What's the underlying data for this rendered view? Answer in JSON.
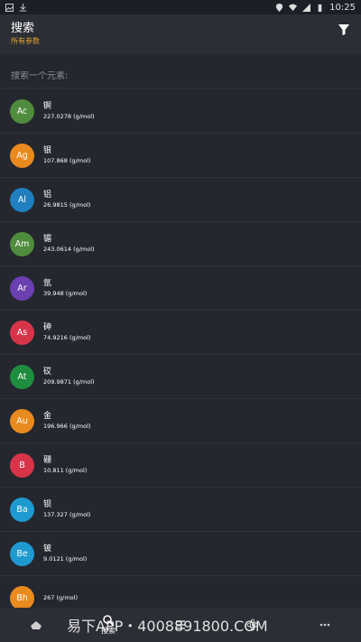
{
  "status_bar": {
    "time": "10:25"
  },
  "app_bar": {
    "title": "搜索",
    "subtitle": "所有参数"
  },
  "search": {
    "placeholder": "搜索一个元素:"
  },
  "elements": [
    {
      "symbol": "Ac",
      "name": "锕",
      "mass": "227.0278 (g/mol)",
      "color": "#4f8c3d"
    },
    {
      "symbol": "Ag",
      "name": "银",
      "mass": "107.868 (g/mol)",
      "color": "#e98a1e"
    },
    {
      "symbol": "Al",
      "name": "铝",
      "mass": "26.9815 (g/mol)",
      "color": "#1f7fbf"
    },
    {
      "symbol": "Am",
      "name": "镅",
      "mass": "243.0614 (g/mol)",
      "color": "#4f8c3d"
    },
    {
      "symbol": "Ar",
      "name": "氩",
      "mass": "39.948 (g/mol)",
      "color": "#6a3fb0"
    },
    {
      "symbol": "As",
      "name": "砷",
      "mass": "74.9216 (g/mol)",
      "color": "#d7344a"
    },
    {
      "symbol": "At",
      "name": "砹",
      "mass": "209.9871 (g/mol)",
      "color": "#1f8c3e"
    },
    {
      "symbol": "Au",
      "name": "金",
      "mass": "196.966 (g/mol)",
      "color": "#e98a1e"
    },
    {
      "symbol": "B",
      "name": "硼",
      "mass": "10.811 (g/mol)",
      "color": "#d7344a"
    },
    {
      "symbol": "Ba",
      "name": "钡",
      "mass": "137.327 (g/mol)",
      "color": "#1f9ad0"
    },
    {
      "symbol": "Be",
      "name": "铍",
      "mass": "9.0121 (g/mol)",
      "color": "#1f9ad0"
    },
    {
      "symbol": "Bh",
      "name": "",
      "mass": "267 (g/mol)",
      "color": "#e98a1e"
    }
  ],
  "bottom_nav": {
    "search_label": "搜索"
  },
  "watermark": {
    "text": "易下APP・4008891800.COM"
  },
  "icons": {
    "filter": "filter-icon",
    "search": "search-icon",
    "menu": "menu-icon",
    "atom": "atom-icon",
    "more": "more-icon"
  }
}
